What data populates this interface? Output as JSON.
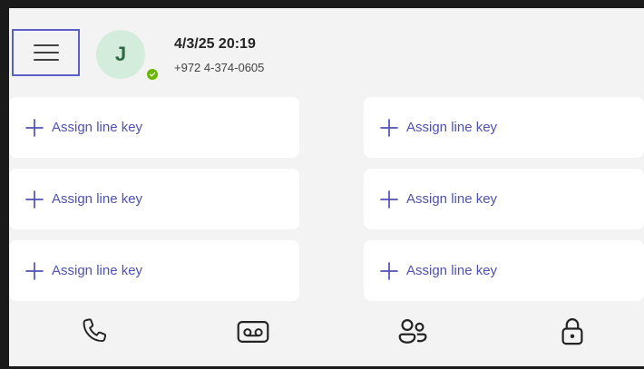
{
  "status": {
    "user_initial": "J",
    "datetime": "4/3/25 20:19",
    "phone_number": "+972 4-374-0605",
    "presence": "available",
    "presence_color": "#6bb700"
  },
  "line_keys": [
    {
      "label": "Assign line key",
      "icon": "plus-icon"
    },
    {
      "label": "Assign line key",
      "icon": "plus-icon"
    },
    {
      "label": "Assign line key",
      "icon": "plus-icon"
    },
    {
      "label": "Assign line key",
      "icon": "plus-icon"
    },
    {
      "label": "Assign line key",
      "icon": "plus-icon"
    },
    {
      "label": "Assign line key",
      "icon": "plus-icon"
    }
  ],
  "nav": [
    {
      "name": "calls",
      "icon": "phone-icon"
    },
    {
      "name": "voicemail",
      "icon": "voicemail-icon"
    },
    {
      "name": "people",
      "icon": "people-icon"
    },
    {
      "name": "lock",
      "icon": "lock-icon"
    }
  ],
  "colors": {
    "accent": "#5b5fc7",
    "link_text": "#4f52b2",
    "background": "#f3f3f3",
    "card": "#ffffff",
    "avatar_bg": "#d3ecdc"
  }
}
